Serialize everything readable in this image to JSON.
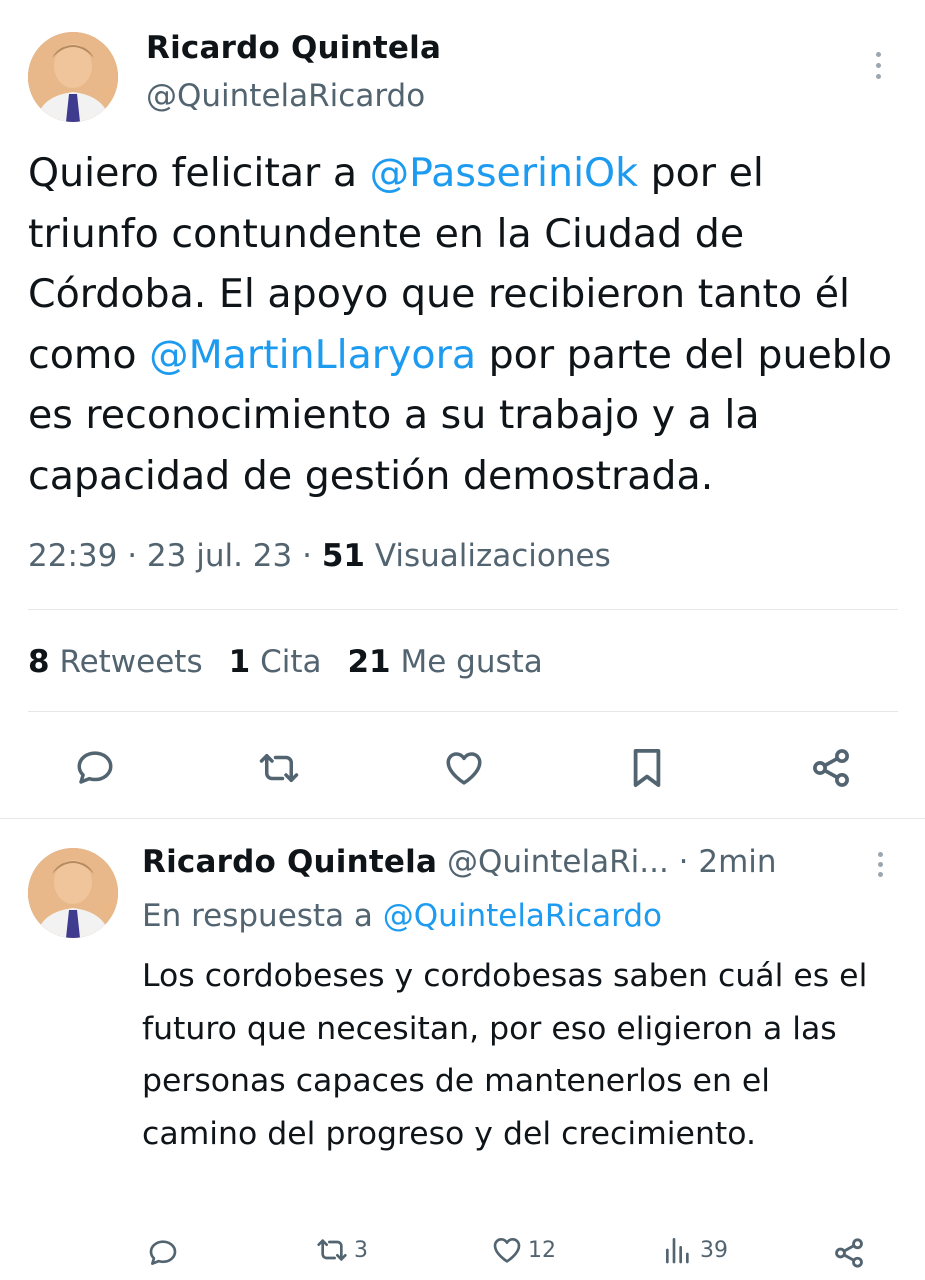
{
  "main_tweet": {
    "author_name": "Ricardo Quintela",
    "author_handle": "@QuintelaRicardo",
    "text_parts": [
      {
        "text": "Quiero felicitar a ",
        "mention": false
      },
      {
        "text": "@PasseriniOk",
        "mention": true
      },
      {
        "text": " por el triunfo contundente en la Ciudad de Córdoba. El apoyo que recibieron tanto él como ",
        "mention": false
      },
      {
        "text": "@MartinLlaryora",
        "mention": true
      },
      {
        "text": " por parte del pueblo es reconocimiento a su trabajo y a la capacidad de gestión demostrada.",
        "mention": false
      }
    ],
    "time": "22:39",
    "date": "23 jul. 23",
    "views_count": "51",
    "views_label": "Visualizaciones",
    "retweets_count": "8",
    "retweets_label": "Retweets",
    "quotes_count": "1",
    "quotes_label": "Cita",
    "likes_count": "21",
    "likes_label": "Me gusta",
    "actions": [
      "reply-icon",
      "retweet-icon",
      "like-icon",
      "bookmark-icon",
      "share-icon"
    ]
  },
  "reply_tweet": {
    "author_name": "Ricardo Quintela",
    "author_handle": "@QuintelaRi...",
    "time_ago": "· 2min",
    "in_reply_prefix": "En respuesta a ",
    "in_reply_handle": "@QuintelaRicardo",
    "text": "Los cordobeses y cordobesas saben cuál es el futuro que necesitan, por eso eligieron a las personas capaces de mantenerlos en el camino del progreso y del crecimiento.",
    "retweets": "3",
    "likes": "12",
    "views": "39"
  },
  "colors": {
    "accent": "#1d9bf0",
    "secondary_text": "#536471",
    "primary_text": "#0f1419",
    "divider": "#e4e8eb"
  }
}
